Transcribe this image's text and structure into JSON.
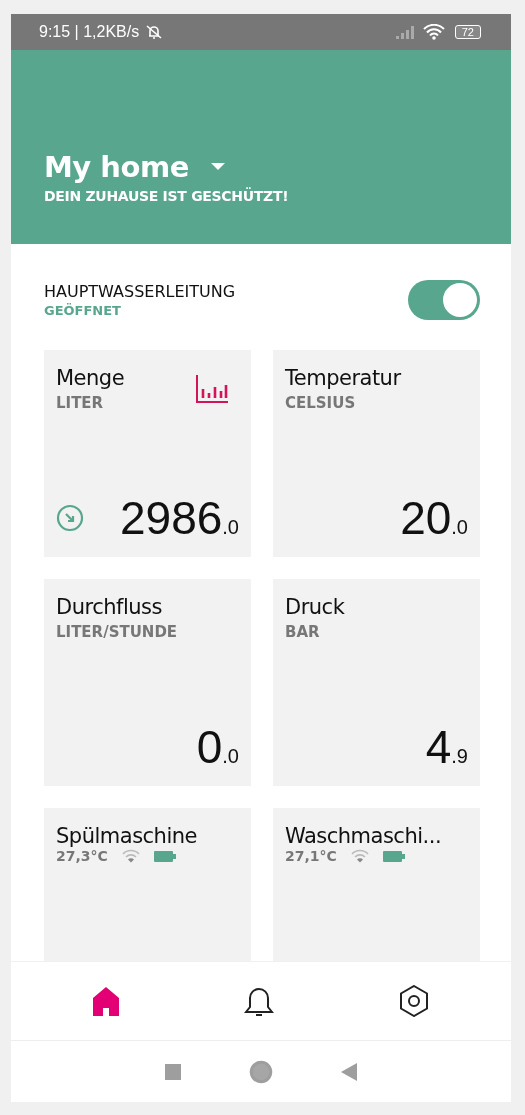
{
  "status_bar": {
    "time": "9:15 | 1,2KB/s",
    "battery": "72"
  },
  "header": {
    "title": "My home",
    "subtitle": "DEIN ZUHAUSE IST GESCHÜTZT!"
  },
  "main_valve": {
    "label": "HAUPTWASSERLEITUNG",
    "state": "GEÖFFNET",
    "on": true
  },
  "cards": [
    {
      "kind": "sensor",
      "title": "Menge",
      "unit": "LITER",
      "value": "2986",
      "decimal": ".0",
      "chart_button": true,
      "trend_arrow": true
    },
    {
      "kind": "sensor",
      "title": "Temperatur",
      "unit": "CELSIUS",
      "value": "20",
      "decimal": ".0",
      "chart_button": false,
      "trend_arrow": false
    },
    {
      "kind": "sensor",
      "title": "Durchfluss",
      "unit": "LITER/STUNDE",
      "value": "0",
      "decimal": ".0",
      "chart_button": false,
      "trend_arrow": false
    },
    {
      "kind": "sensor",
      "title": "Druck",
      "unit": "BAR",
      "value": "4",
      "decimal": ".9",
      "chart_button": false,
      "trend_arrow": false
    },
    {
      "kind": "device",
      "title": "Spülmaschine",
      "temperature": "27,3°C"
    },
    {
      "kind": "device",
      "title": "Waschmaschi...",
      "temperature": "27,1°C"
    }
  ],
  "bottom_nav": [
    {
      "kind": "home",
      "selected": true
    },
    {
      "kind": "bell",
      "selected": false
    },
    {
      "kind": "settings",
      "selected": false
    }
  ]
}
